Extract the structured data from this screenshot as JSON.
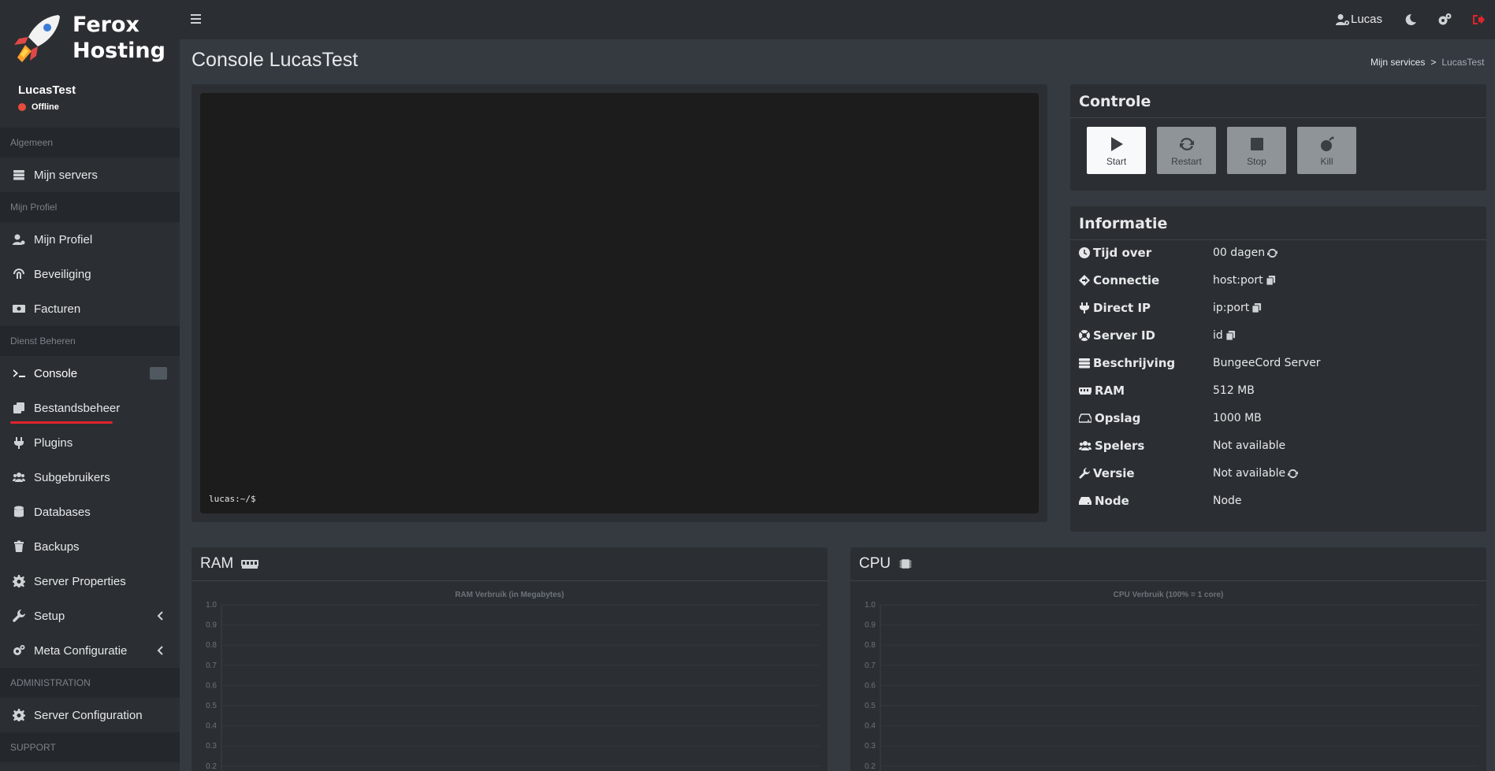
{
  "brand": {
    "line1": "Ferox",
    "line2": "Hosting"
  },
  "server": {
    "name": "LucasTest",
    "status": "Offline"
  },
  "sidebar": {
    "sections": [
      {
        "header": "Algemeen",
        "items": [
          {
            "label": "Mijn servers",
            "icon": "server-icon"
          }
        ]
      },
      {
        "header": "Mijn Profiel",
        "items": [
          {
            "label": "Mijn Profiel",
            "icon": "user-cog-icon"
          },
          {
            "label": "Beveiliging",
            "icon": "fingerprint-icon"
          },
          {
            "label": "Facturen",
            "icon": "money-bill-icon"
          }
        ]
      },
      {
        "header": "Dienst Beheren",
        "items": [
          {
            "label": "Console",
            "icon": "terminal-icon"
          },
          {
            "label": "Bestandsbeheer",
            "icon": "copy-icon"
          },
          {
            "label": "Plugins",
            "icon": "plug-icon"
          },
          {
            "label": "Subgebruikers",
            "icon": "users-icon"
          },
          {
            "label": "Databases",
            "icon": "database-icon"
          },
          {
            "label": "Backups",
            "icon": "trash-icon"
          },
          {
            "label": "Server Properties",
            "icon": "cog-icon"
          },
          {
            "label": "Setup",
            "icon": "wrench-icon"
          },
          {
            "label": "Meta Configuratie",
            "icon": "cogs-icon"
          }
        ]
      },
      {
        "header": "ADMINISTRATION",
        "items": [
          {
            "label": "Server Configuration",
            "icon": "cog-icon"
          }
        ]
      },
      {
        "header": "SUPPORT",
        "items": []
      }
    ]
  },
  "topbar": {
    "user": "Lucas"
  },
  "page": {
    "title": "Console LucasTest"
  },
  "breadcrumb": {
    "parent": "Mijn services",
    "separator": ">",
    "current": "LucasTest"
  },
  "console": {
    "prompt": "lucas:~/$"
  },
  "controle": {
    "title": "Controle",
    "buttons": {
      "start": "Start",
      "restart": "Restart",
      "stop": "Stop",
      "kill": "Kill"
    }
  },
  "informatie": {
    "title": "Informatie",
    "rows": [
      {
        "label": "Tijd over",
        "value": "00 dagen",
        "icon": "clock-icon",
        "action": "refresh-icon"
      },
      {
        "label": "Connectie",
        "value": "host:port",
        "icon": "diamond-arrow-icon",
        "action": "copy-icon"
      },
      {
        "label": "Direct IP",
        "value": "ip:port",
        "icon": "plug-icon",
        "action": "copy-icon"
      },
      {
        "label": "Server ID",
        "value": "id",
        "icon": "life-ring-icon",
        "action": "copy-icon"
      },
      {
        "label": "Beschrijving",
        "value": "BungeeCord Server",
        "icon": "server-icon"
      },
      {
        "label": "RAM",
        "value": "512 MB",
        "icon": "memory-icon"
      },
      {
        "label": "Opslag",
        "value": "1000 MB",
        "icon": "hdd-icon"
      },
      {
        "label": "Spelers",
        "value": "Not available",
        "icon": "users-icon"
      },
      {
        "label": "Versie",
        "value": "Not available",
        "icon": "wrench-icon",
        "action": "refresh-icon"
      },
      {
        "label": "Node",
        "value": "Node",
        "icon": "hdd-icon"
      }
    ]
  },
  "chart_data": [
    {
      "type": "line",
      "panel": "RAM",
      "title": "RAM Verbruik (in Megabytes)",
      "yticks": [
        "1.0",
        "0.9",
        "0.8",
        "0.7",
        "0.6",
        "0.5",
        "0.4",
        "0.3",
        "0.2"
      ],
      "ylim": [
        0,
        1
      ],
      "series": []
    },
    {
      "type": "line",
      "panel": "CPU",
      "title": "CPU Verbruik (100% = 1 core)",
      "yticks": [
        "1.0",
        "0.9",
        "0.8",
        "0.7",
        "0.6",
        "0.5",
        "0.4",
        "0.3",
        "0.2"
      ],
      "ylim": [
        0,
        1
      ],
      "series": []
    }
  ],
  "colors": {
    "accent": "#e0242c",
    "offline": "#e74c3c"
  }
}
